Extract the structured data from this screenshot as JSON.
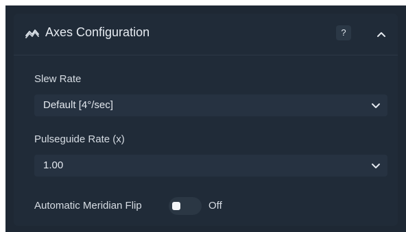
{
  "panel": {
    "title": "Axes Configuration",
    "icon": "axes-icon",
    "help_label": "?",
    "collapse_icon": "chevron-up-icon"
  },
  "fields": {
    "slew_rate": {
      "label": "Slew Rate",
      "value": "Default [4°/sec]"
    },
    "pulseguide_rate": {
      "label": "Pulseguide Rate (x)",
      "value": "1.00"
    },
    "meridian_flip": {
      "label": "Automatic Meridian Flip",
      "state": "Off"
    }
  },
  "colors": {
    "background": "#1e2834",
    "panel": "#202b38",
    "input": "#263241",
    "text": "#e4e9ef"
  }
}
